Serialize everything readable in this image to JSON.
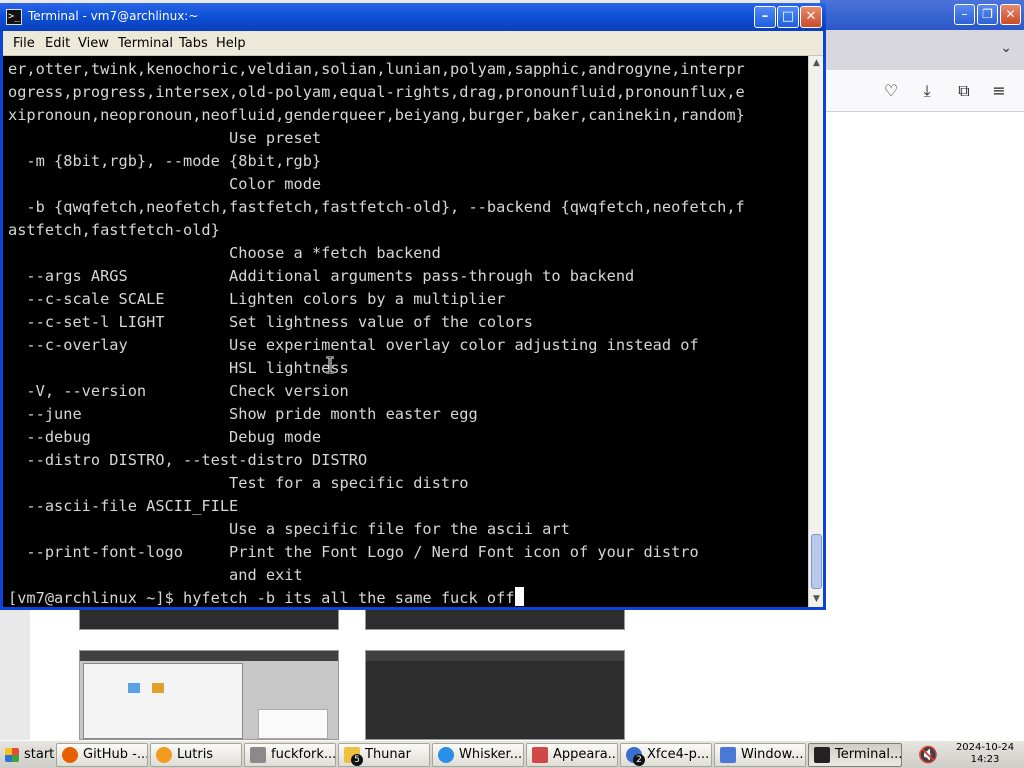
{
  "terminal": {
    "title": "Terminal - vm7@archlinux:~",
    "menu": [
      "File",
      "Edit",
      "View",
      "Terminal",
      "Tabs",
      "Help"
    ],
    "lines": [
      "er,otter,twink,kenochoric,veldian,solian,lunian,polyam,sapphic,androgyne,interpr",
      "ogress,progress,intersex,old-polyam,equal-rights,drag,pronounfluid,pronounflux,e",
      "xipronoun,neopronoun,neofluid,genderqueer,beiyang,burger,baker,caninekin,random}",
      "                        Use preset",
      "  -m {8bit,rgb}, --mode {8bit,rgb}",
      "                        Color mode",
      "  -b {qwqfetch,neofetch,fastfetch,fastfetch-old}, --backend {qwqfetch,neofetch,f",
      "astfetch,fastfetch-old}",
      "                        Choose a *fetch backend",
      "  --args ARGS           Additional arguments pass-through to backend",
      "  --c-scale SCALE       Lighten colors by a multiplier",
      "  --c-set-l LIGHT       Set lightness value of the colors",
      "  --c-overlay           Use experimental overlay color adjusting instead of",
      "                        HSL lightness",
      "  -V, --version         Check version",
      "  --june                Show pride month easter egg",
      "  --debug               Debug mode",
      "  --distro DISTRO, --test-distro DISTRO",
      "                        Test for a specific distro",
      "  --ascii-file ASCII_FILE",
      "                        Use a specific file for the ascii art",
      "  --print-font-logo     Print the Font Logo / Nerd Font icon of your distro",
      "                        and exit"
    ],
    "prompt": "[vm7@archlinux ~]$ ",
    "command": "hyfetch -b its all the same fuck off"
  },
  "taskbar": {
    "start_label": "start",
    "items": [
      {
        "label": "GitHub -...",
        "icon": "firefox-icon",
        "color": "#e66000"
      },
      {
        "label": "Lutris",
        "icon": "lutris-icon",
        "color": "#f39a1f"
      },
      {
        "label": "fuckfork...",
        "icon": "fork-icon",
        "color": "#8a8a8a"
      },
      {
        "label": "Thunar",
        "icon": "folder-icon",
        "color": "#f0c040",
        "badge": "5"
      },
      {
        "label": "Whisker...",
        "icon": "whisker-icon",
        "color": "#2a8fe6"
      },
      {
        "label": "Appeara...",
        "icon": "appearance-icon",
        "color": "#d04848"
      },
      {
        "label": "Xfce4-p...",
        "icon": "xfce-icon",
        "color": "#3a6fd1",
        "badge": "2"
      },
      {
        "label": "Window...",
        "icon": "window-icon",
        "color": "#4a78d6"
      },
      {
        "label": "Terminal...",
        "icon": "terminal-icon",
        "color": "#222222"
      }
    ],
    "clock_date": "2024-10-24",
    "clock_time": "14:23"
  }
}
